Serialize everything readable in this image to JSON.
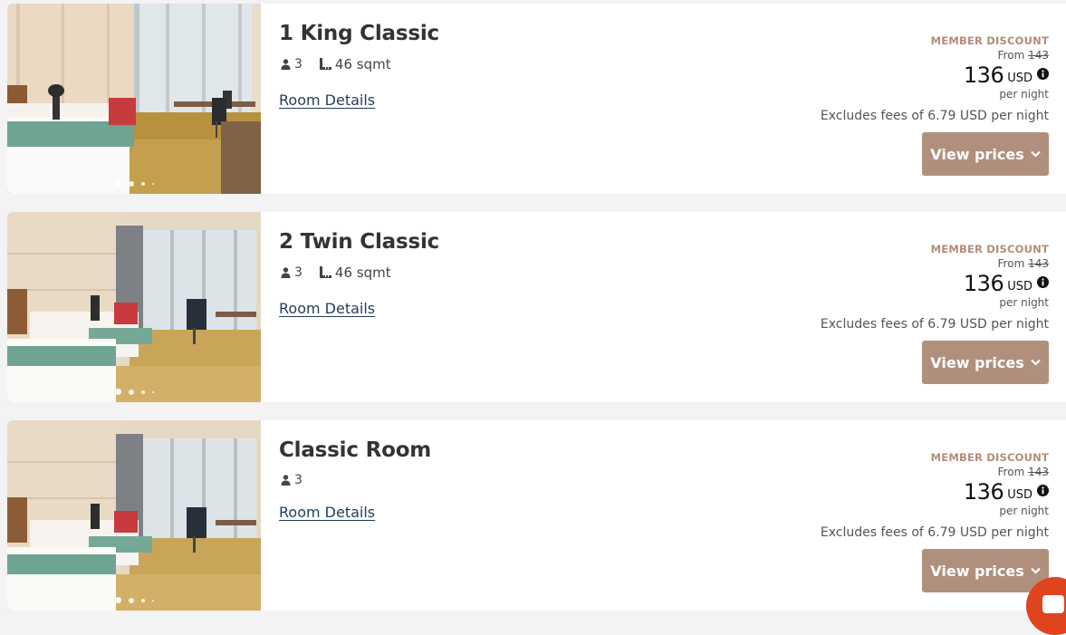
{
  "rooms": [
    {
      "name": "1 King Classic",
      "guests": "3",
      "area": "46 sqmt",
      "details_label": "Room Details",
      "member_label": "MEMBER DISCOUNT",
      "from_label": "From",
      "original_price": "143",
      "price": "136",
      "currency": "USD",
      "per_night": "per night",
      "fees": "Excludes fees of 6.79 USD per night",
      "button_label": "View prices",
      "photo_index": 1,
      "photo_count": 4
    },
    {
      "name": "2 Twin Classic",
      "guests": "3",
      "area": "46 sqmt",
      "details_label": "Room Details",
      "member_label": "MEMBER DISCOUNT",
      "from_label": "From",
      "original_price": "143",
      "price": "136",
      "currency": "USD",
      "per_night": "per night",
      "fees": "Excludes fees of 6.79 USD per night",
      "button_label": "View prices",
      "photo_index": 1,
      "photo_count": 4
    },
    {
      "name": "Classic Room",
      "guests": "3",
      "area": "",
      "details_label": "Room Details",
      "member_label": "MEMBER DISCOUNT",
      "from_label": "From",
      "original_price": "143",
      "price": "136",
      "currency": "USD",
      "per_night": "per night",
      "fees": "Excludes fees of 6.79 USD per night",
      "button_label": "View prices",
      "photo_index": 1,
      "photo_count": 4
    }
  ],
  "icons": {
    "guests": "person-icon",
    "area": "ruler-square-icon",
    "info": "info-circle-icon",
    "chevron": "chevron-down-icon",
    "chat": "chat-bubble-icon"
  },
  "colors": {
    "accent": "#b0907d",
    "member_label": "#b58b79",
    "link": "#1e3d5c",
    "chat": "#e0441f"
  }
}
